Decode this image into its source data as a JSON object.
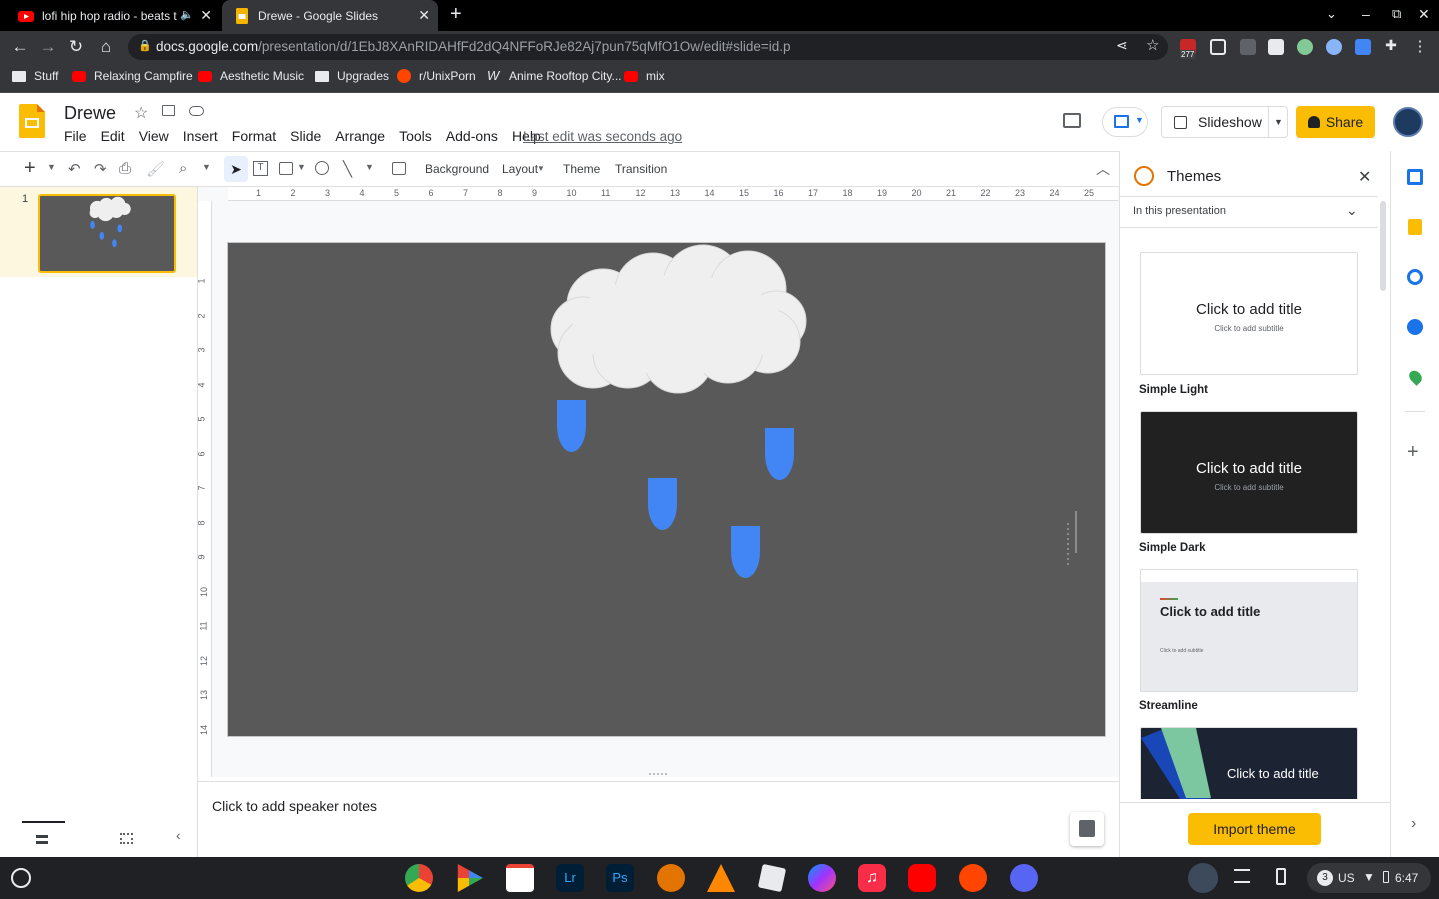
{
  "browser": {
    "tabs": [
      {
        "title": "lofi hip hop radio - beats to r"
      },
      {
        "title": "Drewe - Google Slides"
      }
    ],
    "url_host": "docs.google.com",
    "url_path": "/presentation/d/1EbJ8XAnRIDAHfFd2dQ4NFFoRJe82Aj7pun75qMfO1Ow/edit#slide=id.p",
    "ext_badge": "277",
    "bookmarks": [
      {
        "label": "Stuff",
        "icon": "folder-icon"
      },
      {
        "label": "Relaxing Campfire",
        "icon": "youtube-icon"
      },
      {
        "label": "Aesthetic Music",
        "icon": "youtube-icon"
      },
      {
        "label": "Upgrades",
        "icon": "folder-icon"
      },
      {
        "label": "r/UnixPorn",
        "icon": "reddit-icon"
      },
      {
        "label": "Anime Rooftop City...",
        "icon": "w-icon"
      },
      {
        "label": "mix",
        "icon": "youtube-icon"
      }
    ]
  },
  "slides": {
    "doc_name": "Drewe",
    "menu": [
      "File",
      "Edit",
      "View",
      "Insert",
      "Format",
      "Slide",
      "Arrange",
      "Tools",
      "Add-ons",
      "Help"
    ],
    "last_edit": "Last edit was seconds ago",
    "slideshow_label": "Slideshow",
    "share_label": "Share",
    "toolbar": {
      "background": "Background",
      "layout": "Layout",
      "theme": "Theme",
      "transition": "Transition"
    },
    "slide_number": "1",
    "ruler_h": [
      "1",
      "2",
      "3",
      "4",
      "5",
      "6",
      "7",
      "8",
      "9",
      "10",
      "11",
      "12",
      "13",
      "14",
      "15",
      "16",
      "17",
      "18",
      "19",
      "20",
      "21",
      "22",
      "23",
      "24",
      "25"
    ],
    "ruler_v": [
      "1",
      "2",
      "3",
      "4",
      "5",
      "6",
      "7",
      "8",
      "9",
      "10",
      "11",
      "12",
      "13",
      "14"
    ],
    "speaker_notes": "Click to add speaker notes",
    "colors": {
      "slide_bg": "#595959",
      "cloud": "#efefef",
      "drop": "#4285f4",
      "accent": "#fbbc04"
    }
  },
  "themes": {
    "title": "Themes",
    "scope": "In this presentation",
    "items": [
      {
        "name": "Simple Light",
        "title": "Click to add title",
        "subtitle": "Click to add subtitle"
      },
      {
        "name": "Simple Dark",
        "title": "Click to add title",
        "subtitle": "Click to add subtitle"
      },
      {
        "name": "Streamline",
        "title": "Click to add title",
        "subtitle": "Click to add subtitle"
      },
      {
        "name": "",
        "title": "Click to add title"
      }
    ],
    "import": "Import theme"
  },
  "shelf": {
    "ime": "US",
    "notif": "3",
    "time": "6:47"
  }
}
